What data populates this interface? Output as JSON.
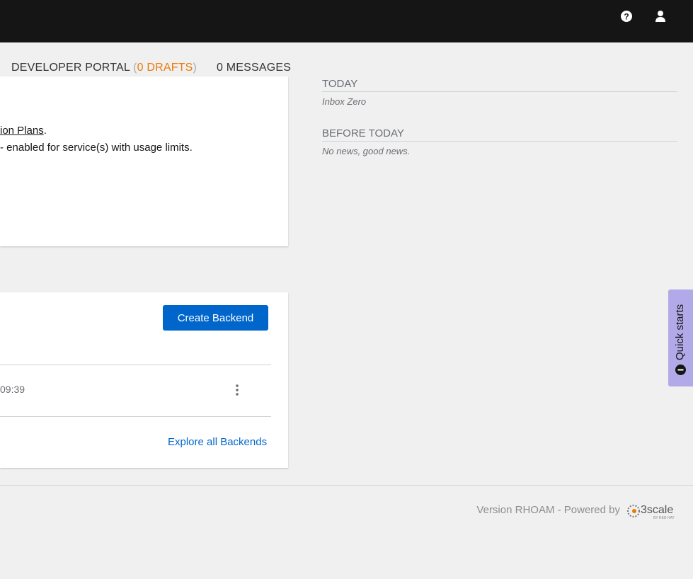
{
  "header": {
    "icons": [
      "help-icon",
      "user-icon"
    ]
  },
  "tabs": {
    "portal": "DEVELOPER PORTAL",
    "open": "(",
    "drafts": "0 DRAFTS",
    "close": ")",
    "messages": "0 MESSAGES"
  },
  "card1": {
    "link": "ion Plans",
    "period": ".",
    "line2": "- enabled for service(s) with usage limits."
  },
  "messages": {
    "today": "TODAY",
    "today_sub": "Inbox Zero",
    "before": "BEFORE TODAY",
    "before_sub": "No news, good news."
  },
  "backends": {
    "create_label": "Create Backend",
    "row_time": "09:39",
    "explore": "Explore all Backends"
  },
  "quickstarts": {
    "label": "Quick starts"
  },
  "footer": {
    "text": "Version RHOAM - Powered by",
    "logo": "3scale",
    "logo_sub": "BY RED HAT"
  }
}
